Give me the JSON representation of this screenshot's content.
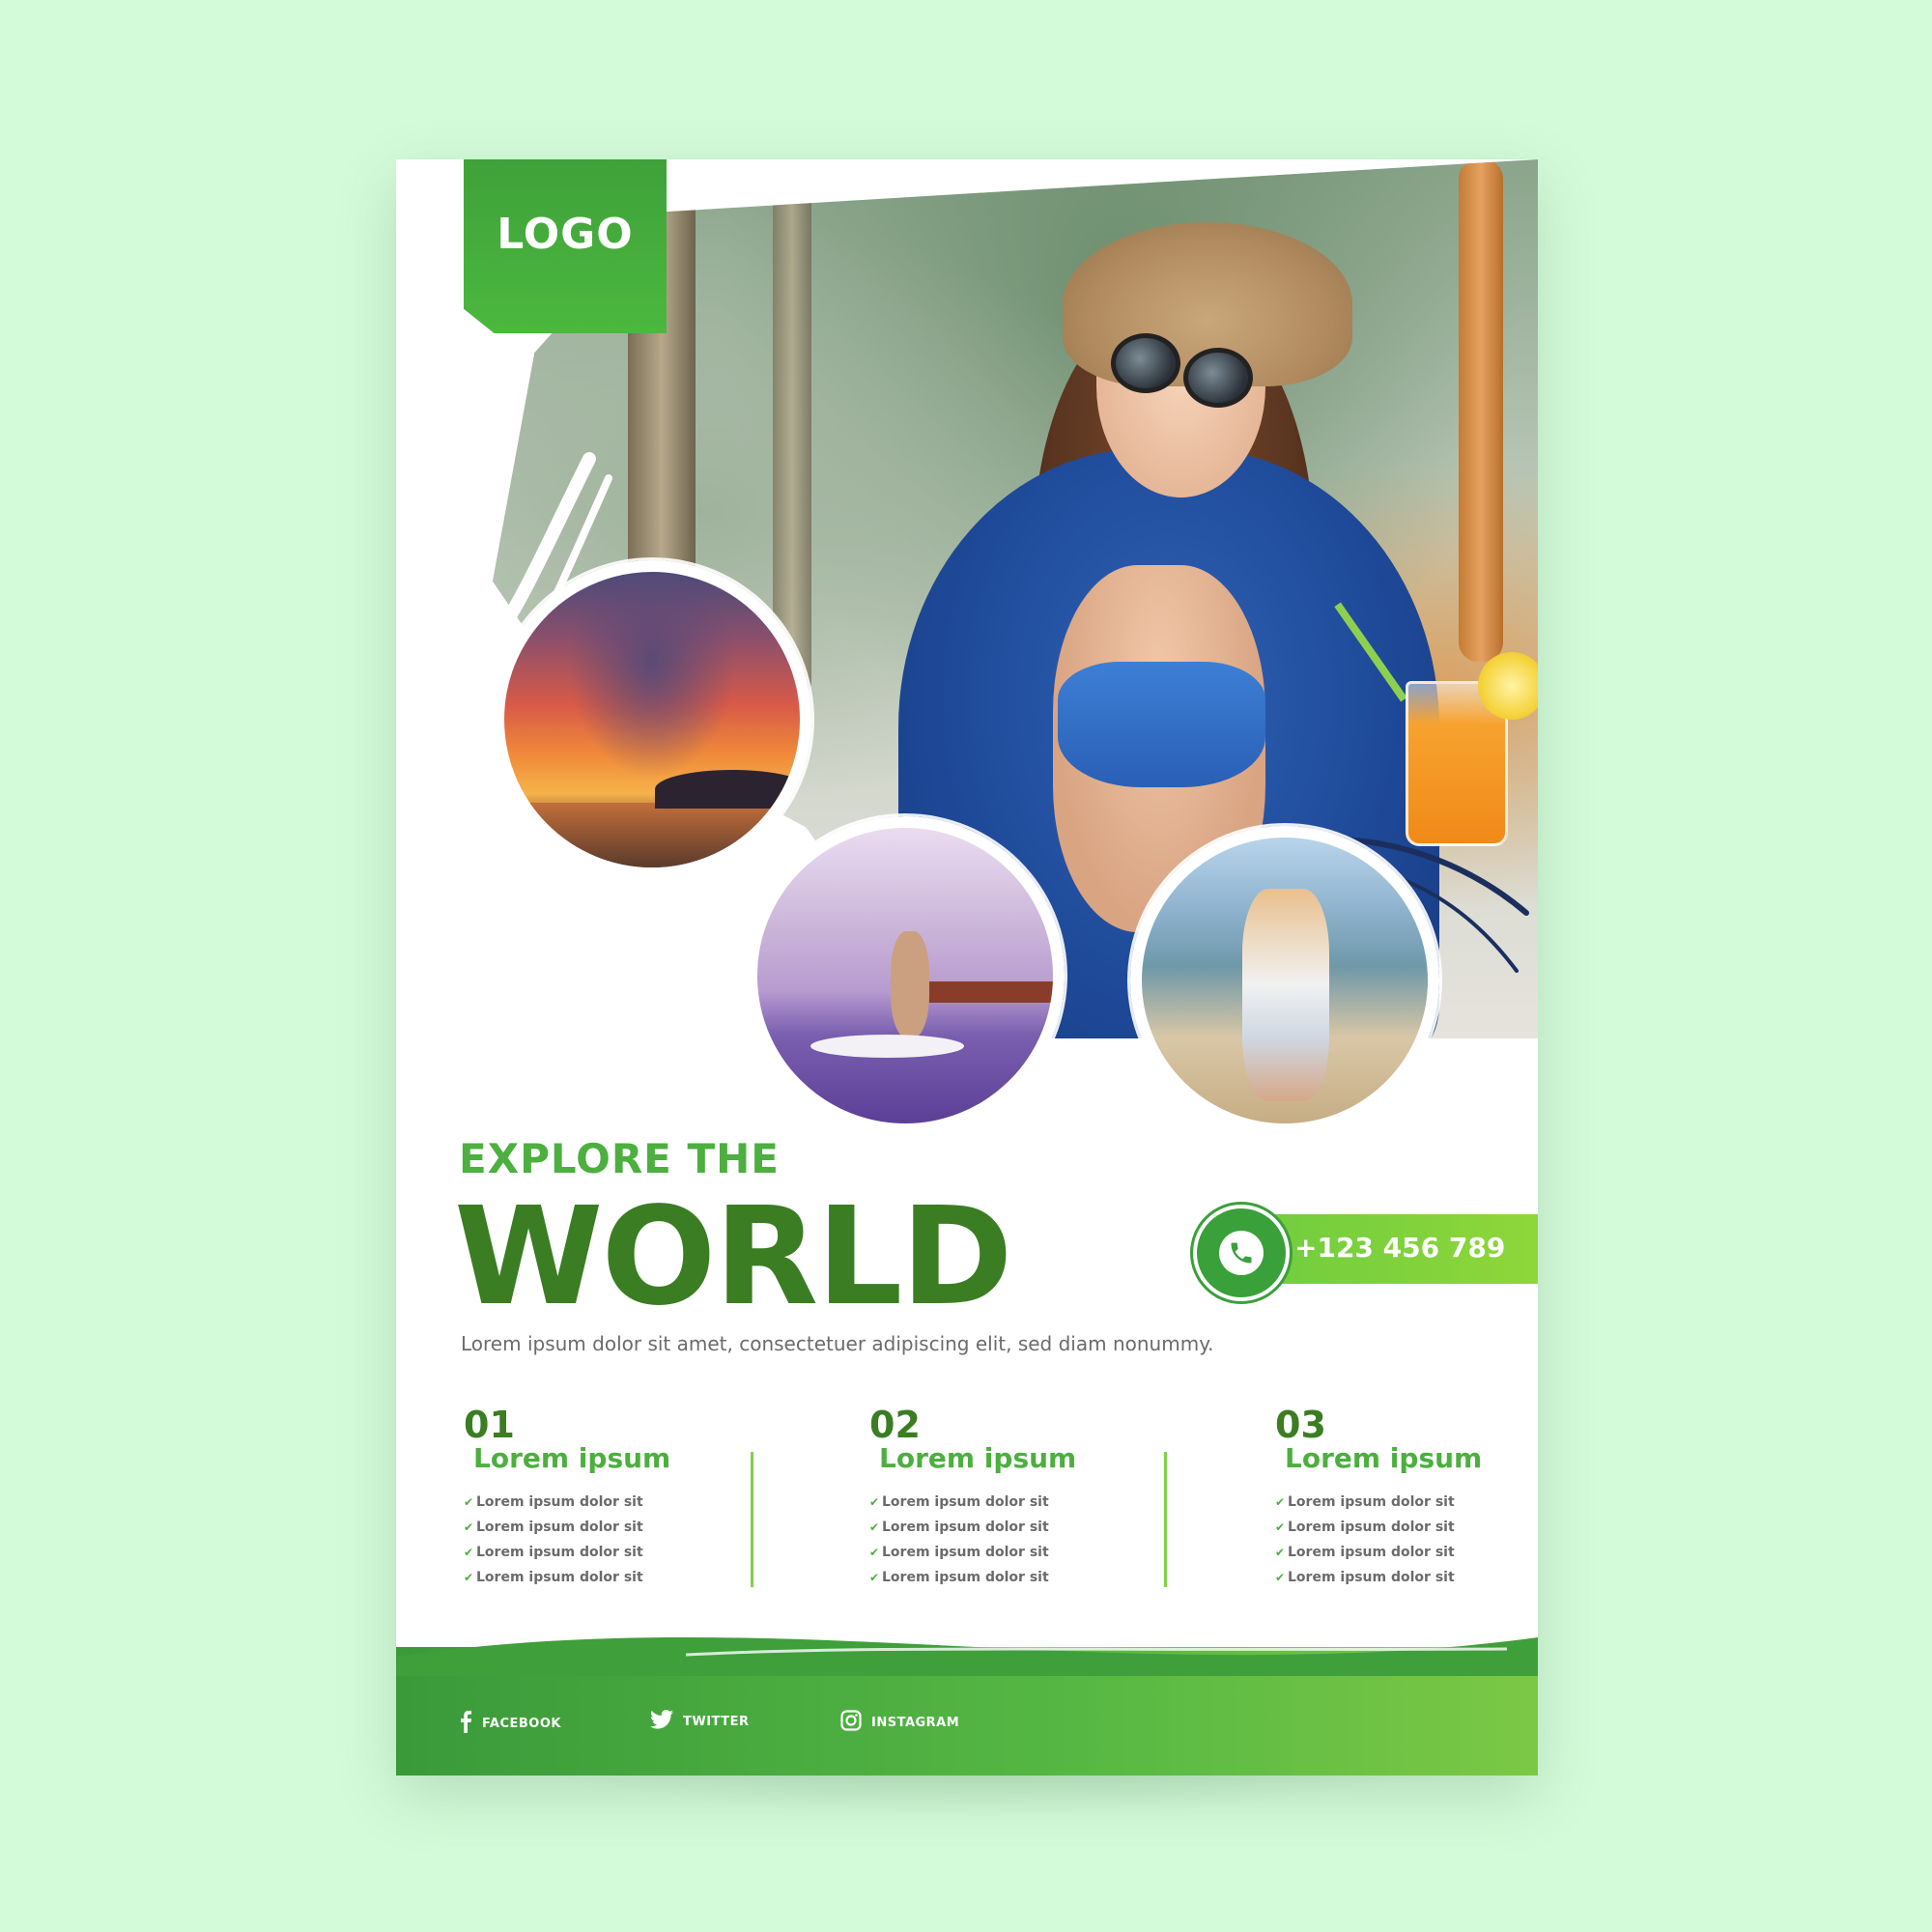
{
  "logo": {
    "text": "LOGO"
  },
  "headline": {
    "kicker": "EXPLORE THE",
    "main": "WORLD",
    "tagline": "Lorem ipsum dolor sit amet, consectetuer adipiscing elit, sed diam nonummy."
  },
  "contact": {
    "phone": "+123 456 789",
    "icon": "phone-icon"
  },
  "columns": [
    {
      "number": "01",
      "title": "Lorem ipsum",
      "items": [
        "Lorem ipsum dolor sit",
        "Lorem ipsum dolor sit",
        "Lorem ipsum dolor sit",
        "Lorem ipsum dolor sit"
      ]
    },
    {
      "number": "02",
      "title": "Lorem ipsum",
      "items": [
        "Lorem ipsum dolor sit",
        "Lorem ipsum dolor sit",
        "Lorem ipsum dolor sit",
        "Lorem ipsum dolor sit"
      ]
    },
    {
      "number": "03",
      "title": "Lorem ipsum",
      "items": [
        "Lorem ipsum dolor sit",
        "Lorem ipsum dolor sit",
        "Lorem ipsum dolor sit",
        "Lorem ipsum dolor sit"
      ]
    }
  ],
  "social": [
    {
      "label": "FACEBOOK",
      "icon": "facebook-icon"
    },
    {
      "label": "TWITTER",
      "icon": "twitter-icon"
    },
    {
      "label": "INSTAGRAM",
      "icon": "instagram-icon"
    }
  ],
  "colors": {
    "background": "#d4fbd9",
    "dark_green": "#3b7d22",
    "green": "#4caf3f",
    "light_green": "#8fd63a"
  }
}
